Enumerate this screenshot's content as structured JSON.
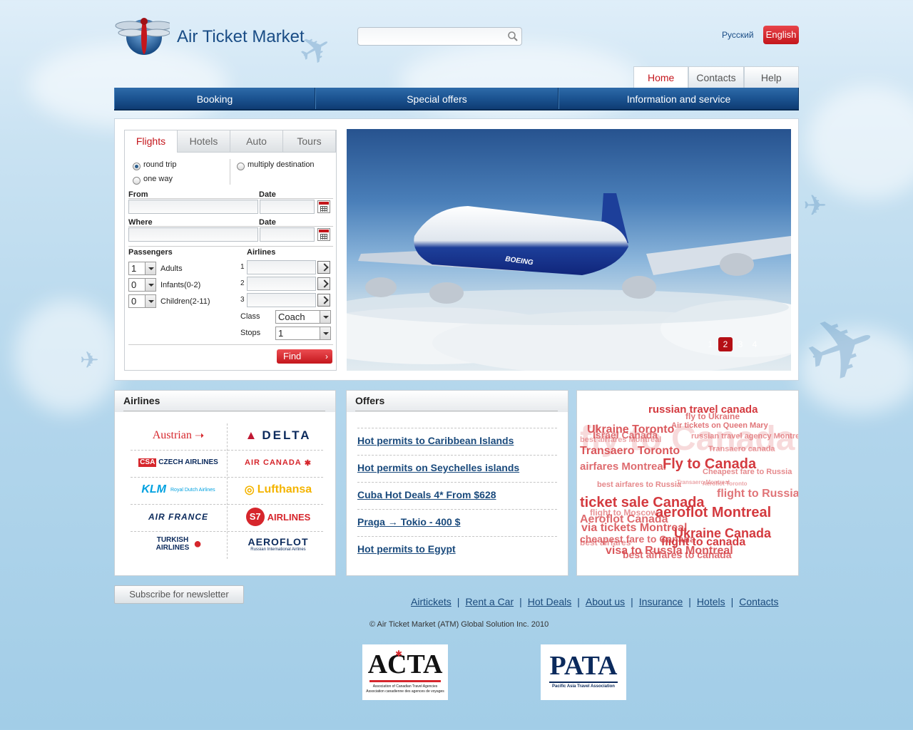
{
  "header": {
    "site_title": "Air Ticket Market",
    "search": {
      "placeholder": "",
      "value": ""
    },
    "lang_ru": "Русский",
    "lang_en": "English"
  },
  "top_tabs": [
    "Home",
    "Contacts",
    "Help"
  ],
  "main_nav": [
    "Booking",
    "Special offers",
    "Information and service"
  ],
  "booking": {
    "tabs": [
      "Flights",
      "Hotels",
      "Auto",
      "Tours"
    ],
    "trip_types": {
      "round_trip": "round trip",
      "one_way": "one way",
      "multi": "multiply destination"
    },
    "from_label": "From",
    "where_label": "Where",
    "date_label": "Date",
    "passengers_label": "Passengers",
    "airlines_label": "Airlines",
    "adults": {
      "value": "1",
      "label": "Adults"
    },
    "infants": {
      "value": "0",
      "label": "Infants(0-2)"
    },
    "children": {
      "value": "0",
      "label": "Children(2-11)"
    },
    "airline_nums": [
      "1",
      "2",
      "3"
    ],
    "class_label": "Class",
    "class_value": "Coach",
    "stops_label": "Stops",
    "stops_value": "1",
    "find": "Find"
  },
  "slider": {
    "aircraft_text": "BOEING",
    "pages": [
      "1",
      "2",
      "3",
      "4"
    ],
    "active_page": "2"
  },
  "airlines_box": {
    "title": "Airlines",
    "logos": [
      "Austrian",
      "DELTA",
      "CZECH AIRLINES",
      "AIR CANADA",
      "KLM",
      "Royal Dutch Airlines",
      "Lufthansa",
      "AIR FRANCE",
      "AIRLINES",
      "TURKISH AIRLINES",
      "AEROFLOT",
      "Russian International Airlines"
    ],
    "s7_mark": "S7",
    "csa_mark": "CSA"
  },
  "offers_box": {
    "title": "Offers",
    "items": [
      "Hot permits to Caribbean Islands",
      "Hot permits on Seychelles islands",
      "Cuba Hot Deals 4* From $628",
      "Praga → Tokio - 400 $",
      "Hot permits to Egypt"
    ]
  },
  "tag_cloud": [
    "russian travel canada",
    "fly to Ukraine",
    "Ukraine Toronto",
    "Air tickets on Queen Mary",
    "Israel Canada",
    "Transaero Toronto",
    "best airfares Montreal",
    "russian travel agency Montreal",
    "Transaero canada",
    "Fly to Canada",
    "Cheapest fare to Russia",
    "airfares Montreal",
    "best airfares to Russia",
    "Transaero Montreal",
    "flight to Russia",
    "ticket sale Canada",
    "aeroflot Montreal",
    "flight to Moscow",
    "Aeroflot Canada",
    "via tickets Montreal",
    "Ukraine Canada",
    "cheapest fare to Canada",
    "best airfares",
    "flight to canada",
    "visa to Russia Montreal",
    "best airfares to canada",
    "Aeroflot Toronto",
    "fly to Canada"
  ],
  "footer": {
    "subscribe": "Subscribe for newsletter",
    "links": [
      "Airtickets",
      "Rent a Car",
      "Hot Deals",
      "About us",
      "Insurance",
      "Hotels",
      "Contacts"
    ],
    "separator": "|",
    "copyright": "© Air Ticket Market (ATM) Global Solution Inc. 2010",
    "acta": {
      "name": "ACTA",
      "line1": "Association of Canadian Travel Agencies",
      "line2": "Association canadienne des agences de voyages"
    },
    "pata": {
      "name": "PATA",
      "line1": "Pacific Asia Travel Association"
    }
  },
  "colors": {
    "brand_red": "#c4161c",
    "nav_blue": "#1b5391",
    "link_blue": "#1a4a7c"
  }
}
